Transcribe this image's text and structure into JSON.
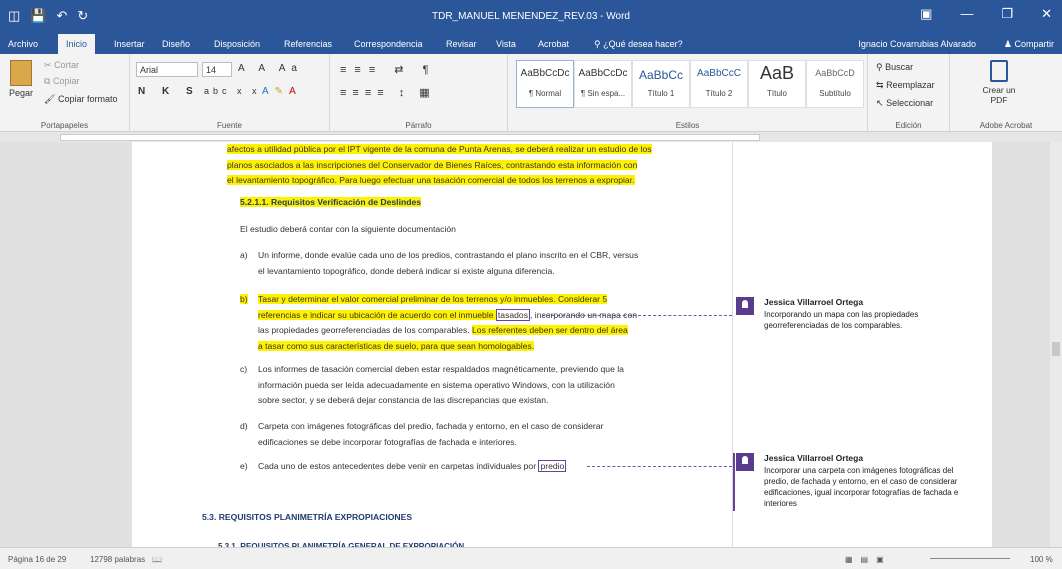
{
  "window": {
    "title": "TDR_MANUEL MENENDEZ_REV.03 - Word",
    "app_icon": "word-icon"
  },
  "tabs": [
    {
      "label": "Archivo"
    },
    {
      "label": "Inicio"
    },
    {
      "label": "Insertar"
    },
    {
      "label": "Diseño"
    },
    {
      "label": "Disposición"
    },
    {
      "label": "Referencias"
    },
    {
      "label": "Correspondencia"
    },
    {
      "label": "Revisar"
    },
    {
      "label": "Vista"
    },
    {
      "label": "Acrobat"
    }
  ],
  "tell_me": "¿Qué desea hacer?",
  "user": "Ignacio Covarrubias Alvarado",
  "share": "Compartir",
  "ribbon": {
    "clipboard": {
      "paste": "Pegar",
      "cut": "Cortar",
      "copy": "Copiar",
      "format_painter": "Copiar formato",
      "label": "Portapapeles"
    },
    "font": {
      "name": "Arial",
      "size": "14",
      "label": "Fuente"
    },
    "paragraph": {
      "label": "Párrafo"
    },
    "styles": {
      "label": "Estilos",
      "items": [
        {
          "sample": "AaBbCcDc",
          "name": "¶ Normal"
        },
        {
          "sample": "AaBbCcDc",
          "name": "¶ Sin espa..."
        },
        {
          "sample": "AaBbCc",
          "name": "Título 1"
        },
        {
          "sample": "AaBbCcC",
          "name": "Título 2"
        },
        {
          "sample": "AaB",
          "name": "Título"
        },
        {
          "sample": "AaBbCcD",
          "name": "Subtítulo"
        }
      ]
    },
    "editing": {
      "find": "Buscar",
      "replace": "Reemplazar",
      "select": "Seleccionar",
      "label": "Edición"
    },
    "acrobat": {
      "create_pdf": "Crear un PDF",
      "label": "Adobe Acrobat"
    }
  },
  "document": {
    "intro_lines": [
      "afectos a utilidad pública por el IPT vigente de la comuna de Punta Arenas, se deberá realizar un estudio de los",
      "planos asociados a las inscripciones del Conservador de Bienes Raíces, contrastando esta información con",
      "el levantamiento topográfico. Para luego efectuar una tasación comercial de todos los terrenos a expropiar."
    ],
    "heading_5211": "5.2.1.1. Requisitos Verificación de Deslindes",
    "lead": "El estudio deberá contar con la siguiente documentación",
    "items": {
      "a": {
        "marker": "a)",
        "line1": "Un informe, donde evalúe cada uno de los predios, contrastando el plano inscrito en el CBR, versus",
        "line2": "el levantamiento topográfico, donde deberá indicar si existe alguna diferencia."
      },
      "b": {
        "marker": "b)",
        "line1": "Tasar y determinar el valor comercial preliminar de los terrenos y/o inmuebles. Considerar 5",
        "line2a": "referencias e indicar su ubicación de acuerdo con el inmueble ",
        "line2b": "tasados",
        "line2c": ", incorporando un mapa con",
        "line3a": "las propiedades georreferenciadas de los comparables. ",
        "line3b": "Los referentes deben ser dentro del área",
        "line4": "a tasar como sus características de suelo, para que sean homologables."
      },
      "c": {
        "marker": "c)",
        "line1": "Los informes de tasación comercial deben estar respaldados magnéticamente, previendo que la",
        "line2": "información pueda ser leída adecuadamente en sistema operativo Windows, con la utilización",
        "line3": "sobre sector, y se deberá dejar constancia de las discrepancias que existan."
      },
      "d": {
        "marker": "d)",
        "line1": "Carpeta con imágenes fotográficas del predio, fachada y entorno, en el caso de considerar",
        "line2": "edificaciones se debe incorporar fotografías de fachada e interiores."
      },
      "e": {
        "marker": "e)",
        "line1a": "Cada uno de estos antecedentes debe venir en carpetas individuales por ",
        "line1b": "predio"
      }
    },
    "heading_53": "5.3.  REQUISITOS PLANIMETRÍA EXPROPIACIONES",
    "heading_531": "5.3.1. REQUISITOS PLANIMETRÍA GENERAL DE EXPROPIACIÓN"
  },
  "comments": [
    {
      "author": "Jessica Villarroel Ortega",
      "body": "Incorporando un mapa con las propiedades georreferenciadas de los comparables."
    },
    {
      "author": "Jessica Villarroel Ortega",
      "body": "Incorporar una carpeta con imágenes fotográficas del predio, de fachada y entorno, en el caso de considerar edificaciones, igual incorporar fotografías de fachada e interiores"
    }
  ],
  "status": {
    "page": "Página 16 de 29",
    "words": "12798 palabras",
    "zoom": "100 %"
  },
  "colors": {
    "ribbon_blue": "#2b579a",
    "highlight": "#fff200",
    "comment_purple": "#5a3c8e"
  }
}
